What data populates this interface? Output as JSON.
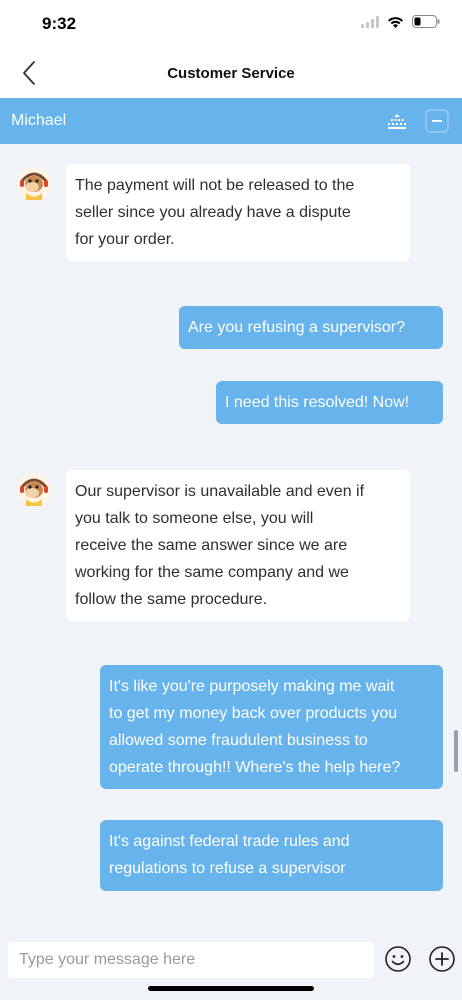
{
  "status_bar": {
    "time": "9:32",
    "icons": [
      "signal-icon",
      "wifi-icon",
      "battery-icon"
    ]
  },
  "nav": {
    "title": "Customer Service",
    "back_icon": "chevron-left-icon"
  },
  "agent_bar": {
    "name": "Michael",
    "icons": [
      "queue-icon",
      "minimize-icon"
    ],
    "color": "#67b3ec"
  },
  "messages": [
    {
      "sender": "agent",
      "text": "The payment will not be released to the\nseller since you already have a dispute\nfor your order."
    },
    {
      "sender": "user",
      "text": "Are you refusing a supervisor?"
    },
    {
      "sender": "user",
      "text": "I need this resolved! Now!"
    },
    {
      "sender": "agent",
      "text": "Our supervisor is unavailable and even if\nyou talk to someone else, you will\nreceive the same answer since we are\nworking for the same company and we\nfollow the same procedure."
    },
    {
      "sender": "user",
      "text": "It's like you're purposely making me wait\nto get my money back over products you\nallowed some fraudulent business to\noperate through!! Where's the help here?"
    },
    {
      "sender": "user",
      "text": "It's against federal trade rules and\nregulations to refuse a supervisor"
    }
  ],
  "input": {
    "placeholder": "Type your message here",
    "value": "",
    "icons": [
      "emoji-icon",
      "add-icon"
    ]
  },
  "colors": {
    "accent": "#67b3ec",
    "chat_background": "#f0f3f8",
    "agent_bubble": "#ffffff",
    "user_bubble": "#67b3ec"
  }
}
